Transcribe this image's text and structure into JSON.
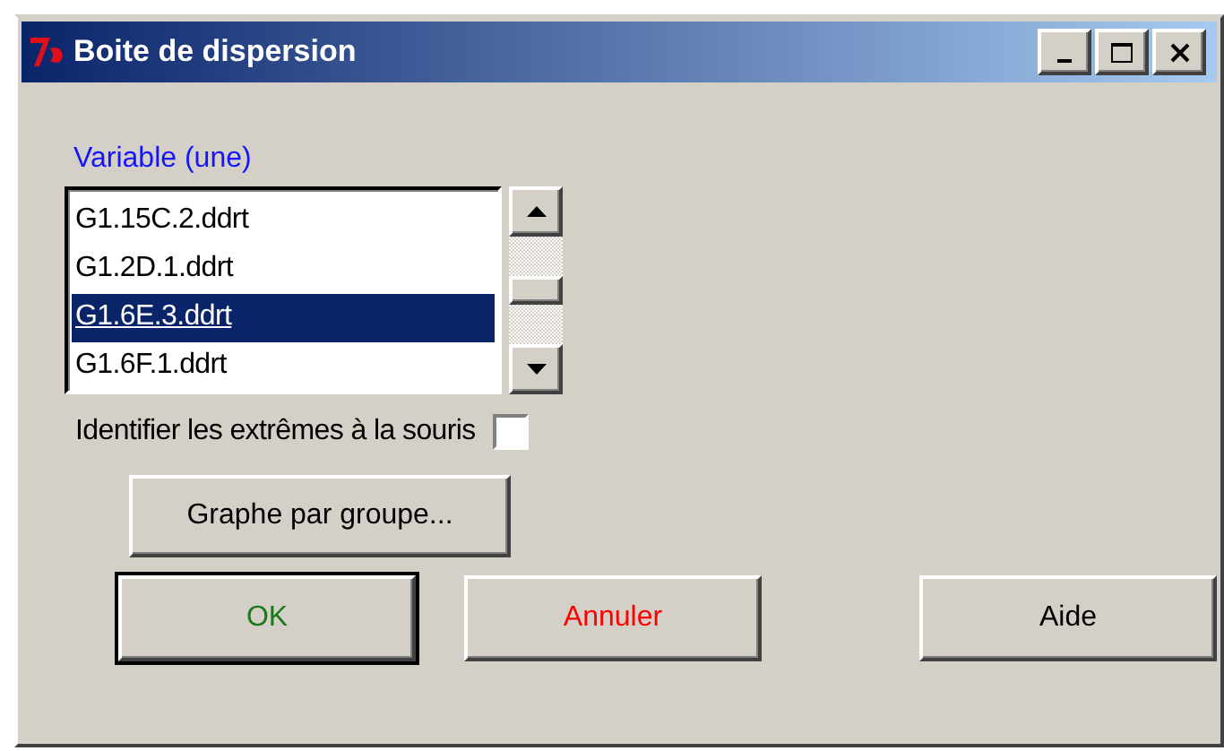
{
  "window": {
    "title": "Boite de dispersion"
  },
  "variable_list": {
    "label": "Variable (une)",
    "items": [
      {
        "text": "G1.15C.2.ddrt",
        "selected": false
      },
      {
        "text": "G1.2D.1.ddrt",
        "selected": false
      },
      {
        "text": "G1.6E.3.ddrt",
        "selected": true
      },
      {
        "text": "G1.6F.1.ddrt",
        "selected": false
      }
    ]
  },
  "identify_extremes": {
    "label": "Identifier les extrêmes à la souris",
    "checked": false
  },
  "group_button": "Graphe par groupe...",
  "buttons": [
    {
      "label": "OK",
      "color": "#1a7a1a",
      "default": true
    },
    {
      "label": "Annuler",
      "color": "#ff0000",
      "default": false
    },
    {
      "label": "Aide",
      "color": "#000000",
      "default": false
    }
  ]
}
